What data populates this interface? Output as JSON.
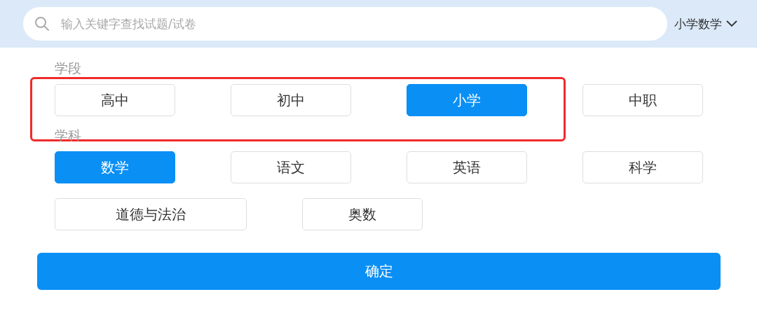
{
  "search": {
    "placeholder": "输入关键字查找试题/试卷"
  },
  "current_selection": "小学数学",
  "sections": [
    {
      "label": "学段",
      "highlighted": true,
      "options": [
        {
          "label": "高中",
          "selected": false,
          "wide": false
        },
        {
          "label": "初中",
          "selected": false,
          "wide": false
        },
        {
          "label": "小学",
          "selected": true,
          "wide": false
        },
        {
          "label": "中职",
          "selected": false,
          "wide": false
        }
      ]
    },
    {
      "label": "学科",
      "highlighted": false,
      "options": [
        {
          "label": "数学",
          "selected": true,
          "wide": false
        },
        {
          "label": "语文",
          "selected": false,
          "wide": false
        },
        {
          "label": "英语",
          "selected": false,
          "wide": false
        },
        {
          "label": "科学",
          "selected": false,
          "wide": false
        },
        {
          "label": "道德与法治",
          "selected": false,
          "wide": true
        },
        {
          "label": "奥数",
          "selected": false,
          "wide": false
        }
      ]
    }
  ],
  "confirm_button": "确定"
}
